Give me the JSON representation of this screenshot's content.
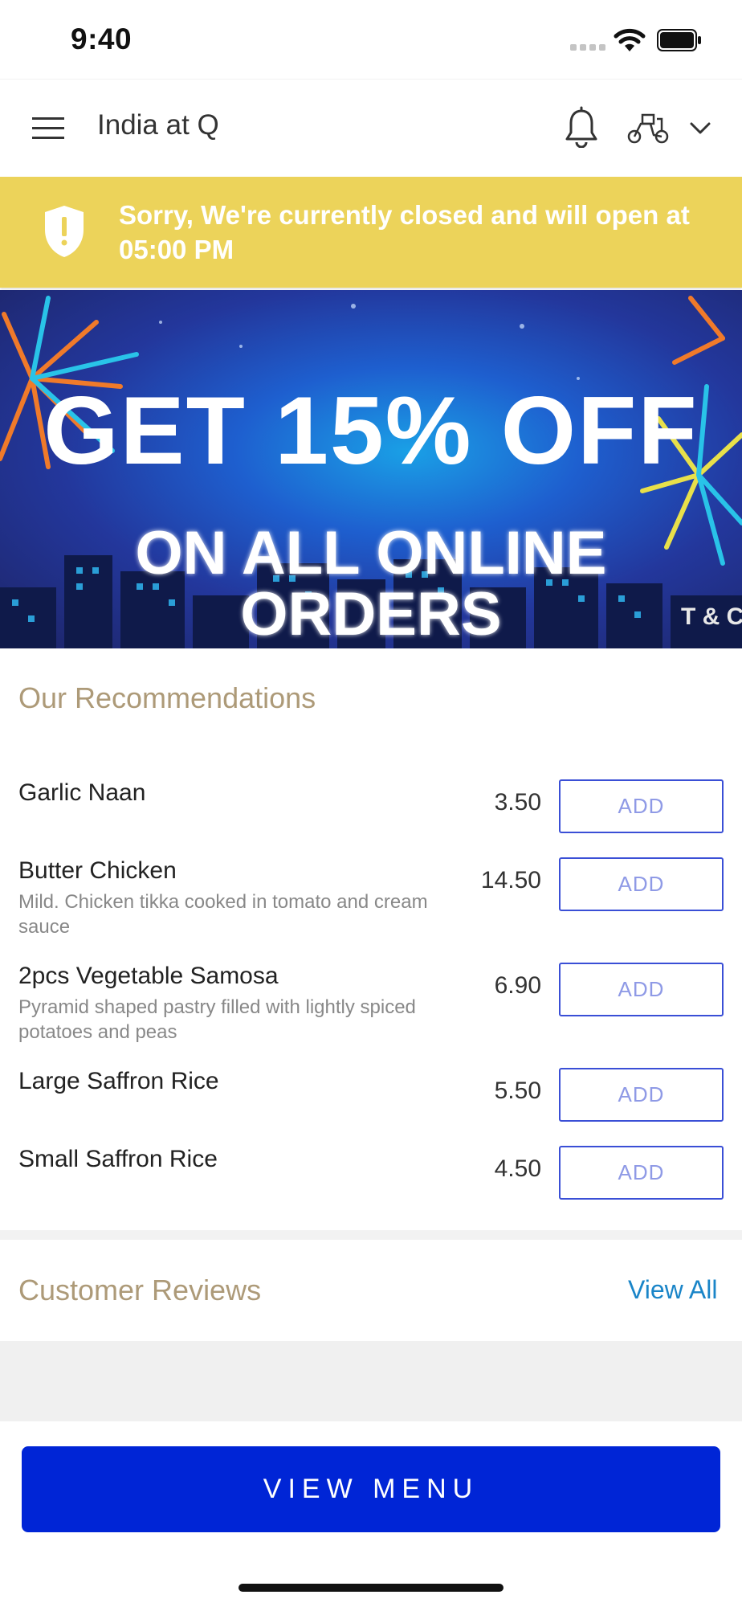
{
  "status_bar": {
    "time": "9:40"
  },
  "header": {
    "title": "India at Q"
  },
  "closed_banner": {
    "message": "Sorry, We're currently closed and will open at 05:00 PM"
  },
  "promo": {
    "line1": "GET 15% OFF",
    "line2": "ON ALL ONLINE ORDERS",
    "terms": "T & C"
  },
  "recommendations": {
    "heading": "Our Recommendations",
    "add_label": "ADD",
    "items": [
      {
        "name": "Garlic Naan",
        "description": "",
        "price": "3.50"
      },
      {
        "name": "Butter Chicken",
        "description": "Mild. Chicken tikka cooked in tomato and cream sauce",
        "price": "14.50"
      },
      {
        "name": "2pcs Vegetable Samosa",
        "description": "Pyramid shaped pastry filled with lightly spiced potatoes and peas",
        "price": "6.90"
      },
      {
        "name": "Large Saffron Rice",
        "description": "",
        "price": "5.50"
      },
      {
        "name": "Small Saffron Rice",
        "description": "",
        "price": "4.50"
      }
    ]
  },
  "reviews": {
    "heading": "Customer Reviews",
    "view_all": "View All"
  },
  "bottom": {
    "view_menu": "VIEW MENU"
  },
  "colors": {
    "banner_yellow": "#ecd35a",
    "accent_gold": "#ad9a78",
    "primary_blue": "#0025d6",
    "link_blue": "#1a85c8"
  }
}
